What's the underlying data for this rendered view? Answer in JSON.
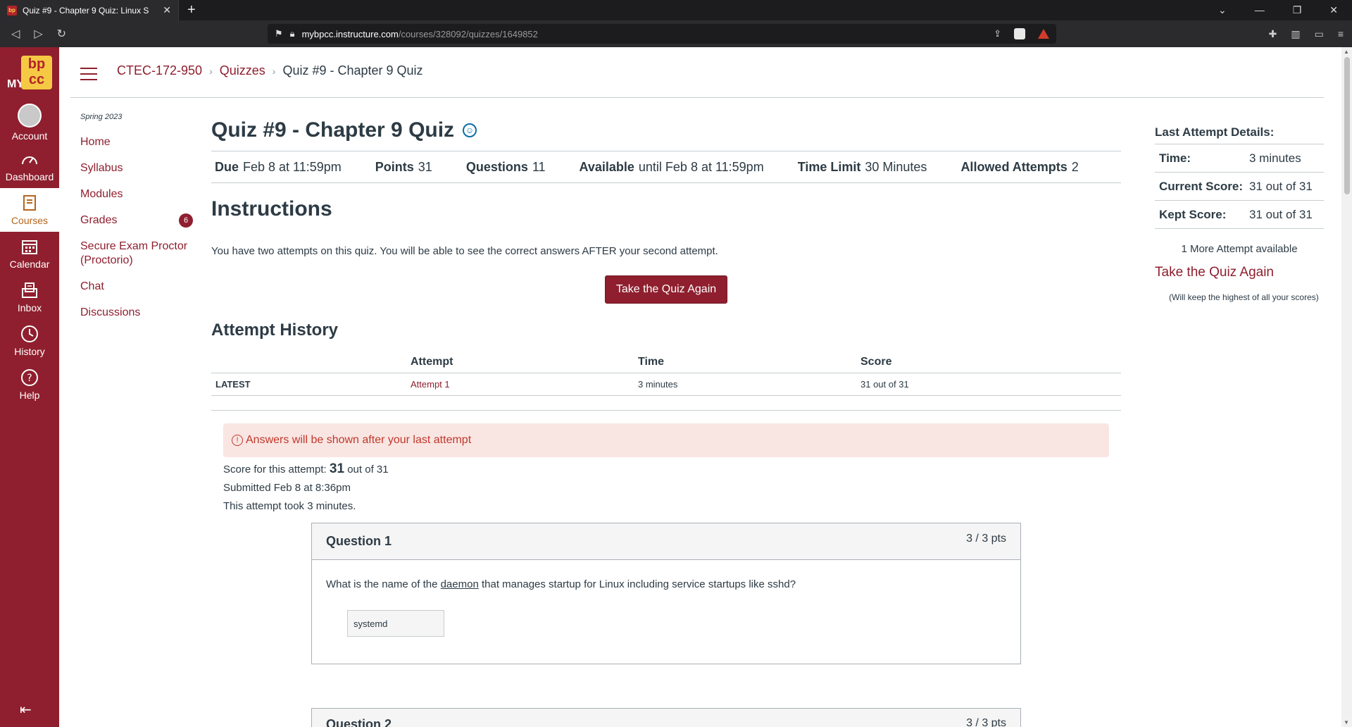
{
  "browser": {
    "tab_title": "Quiz #9 - Chapter 9 Quiz: Linux S",
    "new_tab": "+",
    "url_host": "mybpcc.instructure.com",
    "url_path": "/courses/328092/quizzes/1649852"
  },
  "global_nav": {
    "logo_my": "MY",
    "logo_bp": "bp",
    "logo_cc": "cc",
    "items": [
      {
        "label": "Account"
      },
      {
        "label": "Dashboard"
      },
      {
        "label": "Courses"
      },
      {
        "label": "Calendar"
      },
      {
        "label": "Inbox"
      },
      {
        "label": "History"
      },
      {
        "label": "Help"
      }
    ]
  },
  "breadcrumb": {
    "course": "CTEC-172-950",
    "section": "Quizzes",
    "current": "Quiz #9 - Chapter 9 Quiz"
  },
  "course_nav": {
    "term": "Spring 2023",
    "items": [
      {
        "label": "Home"
      },
      {
        "label": "Syllabus"
      },
      {
        "label": "Modules"
      },
      {
        "label": "Grades",
        "badge": "6"
      },
      {
        "label": "Secure Exam Proctor (Proctorio)"
      },
      {
        "label": "Chat"
      },
      {
        "label": "Discussions"
      }
    ]
  },
  "quiz": {
    "title": "Quiz #9 - Chapter 9 Quiz",
    "details": {
      "due_label": "Due",
      "due_value": "Feb 8 at 11:59pm",
      "points_label": "Points",
      "points_value": "31",
      "questions_label": "Questions",
      "questions_value": "11",
      "available_label": "Available",
      "available_value": "until Feb 8 at 11:59pm",
      "time_limit_label": "Time Limit",
      "time_limit_value": "30 Minutes",
      "attempts_label": "Allowed Attempts",
      "attempts_value": "2"
    },
    "instructions_heading": "Instructions",
    "instructions_text": "You have two attempts on this quiz. You will be able to see the correct answers AFTER your second attempt.",
    "take_again_button": "Take the Quiz Again"
  },
  "attempt_history": {
    "title": "Attempt History",
    "headers": [
      "",
      "Attempt",
      "Time",
      "Score"
    ],
    "rows": [
      {
        "label": "LATEST",
        "attempt": "Attempt 1",
        "time": "3 minutes",
        "score": "31 out of 31"
      }
    ]
  },
  "results": {
    "alert": "Answers will be shown after your last attempt",
    "score_prefix": "Score for this attempt:",
    "score_value": "31",
    "score_suffix": "out of 31",
    "submitted": "Submitted Feb 8 at 8:36pm",
    "duration": "This attempt took 3 minutes."
  },
  "questions": [
    {
      "name": "Question 1",
      "points": "3 / 3 pts",
      "text_before": "What is the name of the ",
      "text_link": "daemon",
      "text_after": " that manages startup for Linux including service startups like sshd?",
      "answer": "systemd"
    },
    {
      "name": "Question 2",
      "points": "3 / 3 pts"
    }
  ],
  "sidebar": {
    "title": "Last Attempt Details:",
    "rows": [
      {
        "label": "Time:",
        "value": "3 minutes"
      },
      {
        "label": "Current Score:",
        "value": "31 out of 31"
      },
      {
        "label": "Kept Score:",
        "value": "31 out of 31"
      }
    ],
    "more_attempts": "1 More Attempt available",
    "take_again_link": "Take the Quiz Again",
    "keep_note": "(Will keep the highest of all your scores)"
  }
}
